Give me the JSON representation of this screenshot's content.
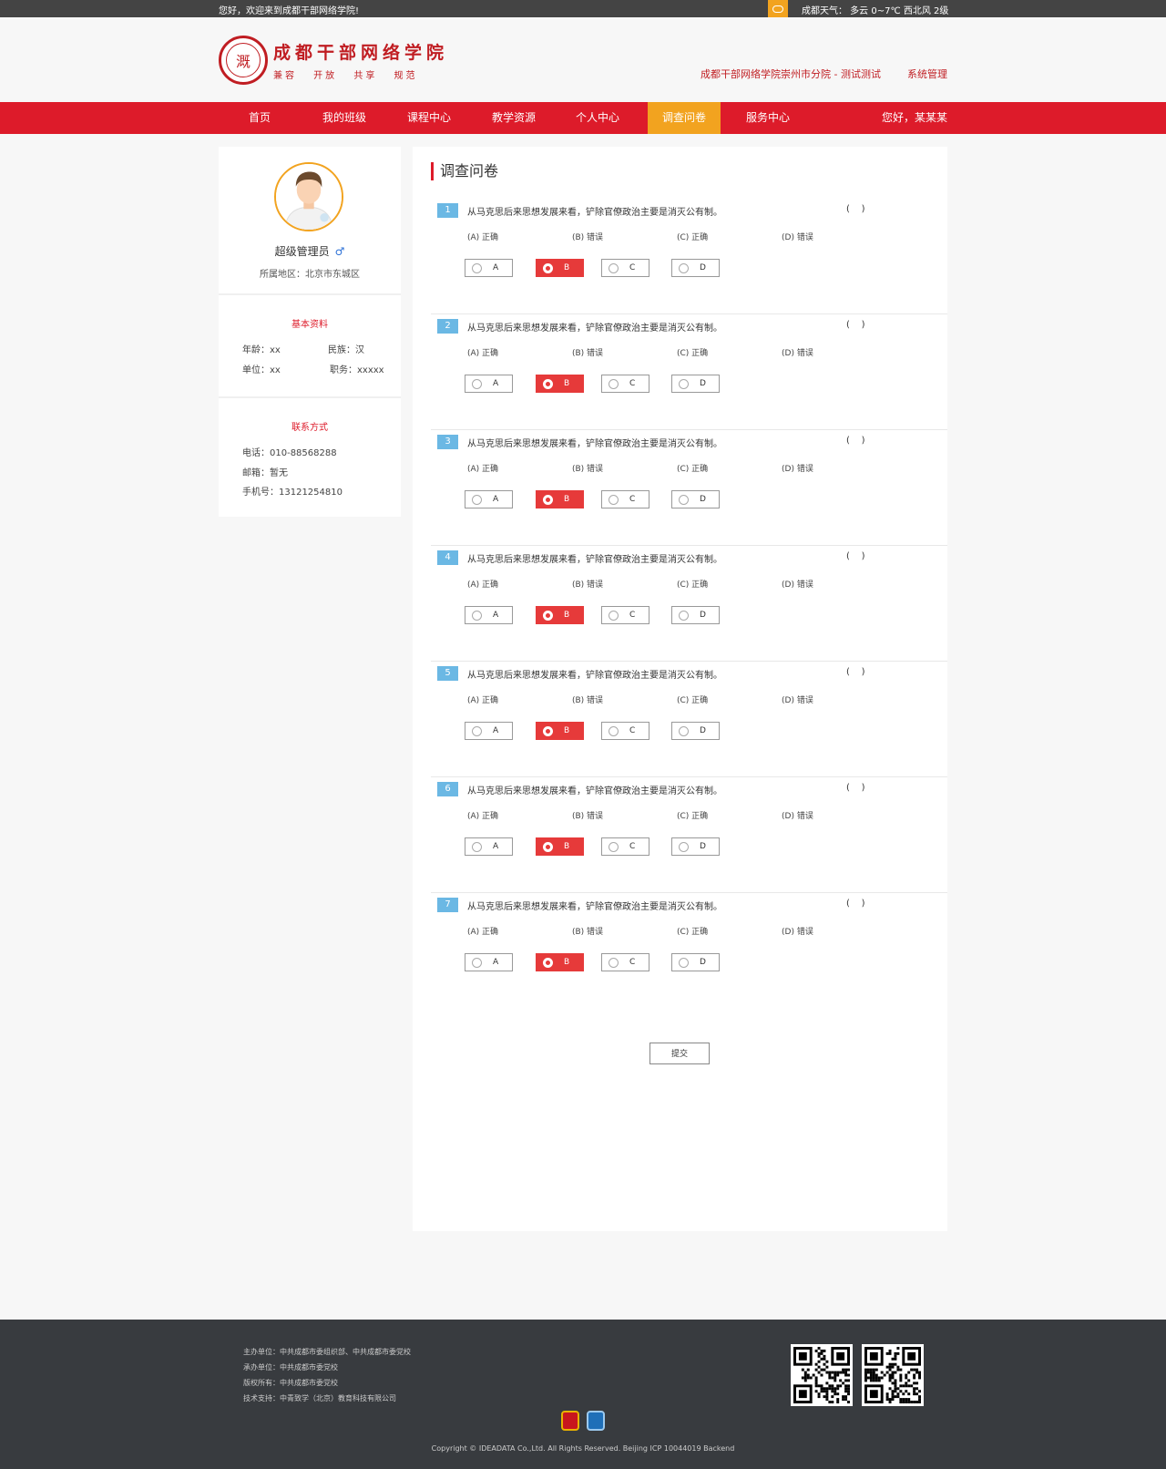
{
  "topbar": {
    "welcome": "您好，欢迎来到成都干部网络学院!",
    "weather": "成都天气：  多云 0~7℃   西北风 2级",
    "weather_icon": "cloud-icon"
  },
  "header": {
    "logo_seal_char": "溉",
    "logo_title": "成都干部网络学院",
    "logo_slogan": "兼容 开放 共享 规范",
    "branch": "成都干部网络学院崇州市分院 - 测试测试",
    "sysadmin": "系统管理"
  },
  "nav": {
    "items": [
      "首页",
      "我的班级",
      "课程中心",
      "教学资源",
      "个人中心",
      "调查问卷",
      "服务中心"
    ],
    "active_index": 5,
    "greeting": "您好，某某某"
  },
  "sidebar": {
    "name": "超级管理员",
    "gender_symbol": "♂",
    "region": "所属地区：北京市东城区",
    "basic_title": "基本资料",
    "age": "年龄：xx",
    "ethnicity": "民族：汉",
    "unit": "单位：xx",
    "position": "职务：xxxxx",
    "contact_title": "联系方式",
    "phone": "电话：010-88568288",
    "email": "邮箱：暂无",
    "mobile": "手机号：13121254810"
  },
  "main": {
    "title": "调查问卷",
    "paren": "(    )",
    "questions": [
      {
        "num": "1",
        "text": "从马克思后来思想发展来看，铲除官僚政治主要是消灭公有制。",
        "options": [
          "(A) 正确",
          "(B) 错误",
          "(C) 正确",
          "(D) 错误"
        ],
        "choices": [
          "A",
          "B",
          "C",
          "D"
        ],
        "selected": "B"
      },
      {
        "num": "2",
        "text": "从马克思后来思想发展来看，铲除官僚政治主要是消灭公有制。",
        "options": [
          "(A) 正确",
          "(B) 错误",
          "(C) 正确",
          "(D) 错误"
        ],
        "choices": [
          "A",
          "B",
          "C",
          "D"
        ],
        "selected": "B"
      },
      {
        "num": "3",
        "text": "从马克思后来思想发展来看，铲除官僚政治主要是消灭公有制。",
        "options": [
          "(A) 正确",
          "(B) 错误",
          "(C) 正确",
          "(D) 错误"
        ],
        "choices": [
          "A",
          "B",
          "C",
          "D"
        ],
        "selected": "B"
      },
      {
        "num": "4",
        "text": "从马克思后来思想发展来看，铲除官僚政治主要是消灭公有制。",
        "options": [
          "(A) 正确",
          "(B) 错误",
          "(C) 正确",
          "(D) 错误"
        ],
        "choices": [
          "A",
          "B",
          "C",
          "D"
        ],
        "selected": "B"
      },
      {
        "num": "5",
        "text": "从马克思后来思想发展来看，铲除官僚政治主要是消灭公有制。",
        "options": [
          "(A) 正确",
          "(B) 错误",
          "(C) 正确",
          "(D) 错误"
        ],
        "choices": [
          "A",
          "B",
          "C",
          "D"
        ],
        "selected": "B"
      },
      {
        "num": "6",
        "text": "从马克思后来思想发展来看，铲除官僚政治主要是消灭公有制。",
        "options": [
          "(A) 正确",
          "(B) 错误",
          "(C) 正确",
          "(D) 错误"
        ],
        "choices": [
          "A",
          "B",
          "C",
          "D"
        ],
        "selected": "B"
      },
      {
        "num": "7",
        "text": "从马克思后来思想发展来看，铲除官僚政治主要是消灭公有制。",
        "options": [
          "(A) 正确",
          "(B) 错误",
          "(C) 正确",
          "(D) 错误"
        ],
        "choices": [
          "A",
          "B",
          "C",
          "D"
        ],
        "selected": "B"
      }
    ],
    "submit_label": "提交"
  },
  "footer": {
    "lines": [
      "主办单位：中共成都市委组织部、中共成都市委党校",
      "承办单位：中共成都市委党校",
      "版权所有：中共成都市委党校",
      "技术支持：中青致学（北京）教育科技有限公司"
    ],
    "copyright": "Copyright © IDEADATA Co.,Ltd. All Rights Reserved. Beijing ICP 10044019 Backend",
    "badges": [
      "party-emblem-icon",
      "government-badge-icon"
    ],
    "qr_codes": [
      "qr-code-icon",
      "qr-code-icon"
    ]
  },
  "colors": {
    "brand_red": "#dd1b2a",
    "accent_orange": "#f2a31f",
    "question_blue": "#6bb8e4",
    "selected_red": "#e63a3a"
  }
}
